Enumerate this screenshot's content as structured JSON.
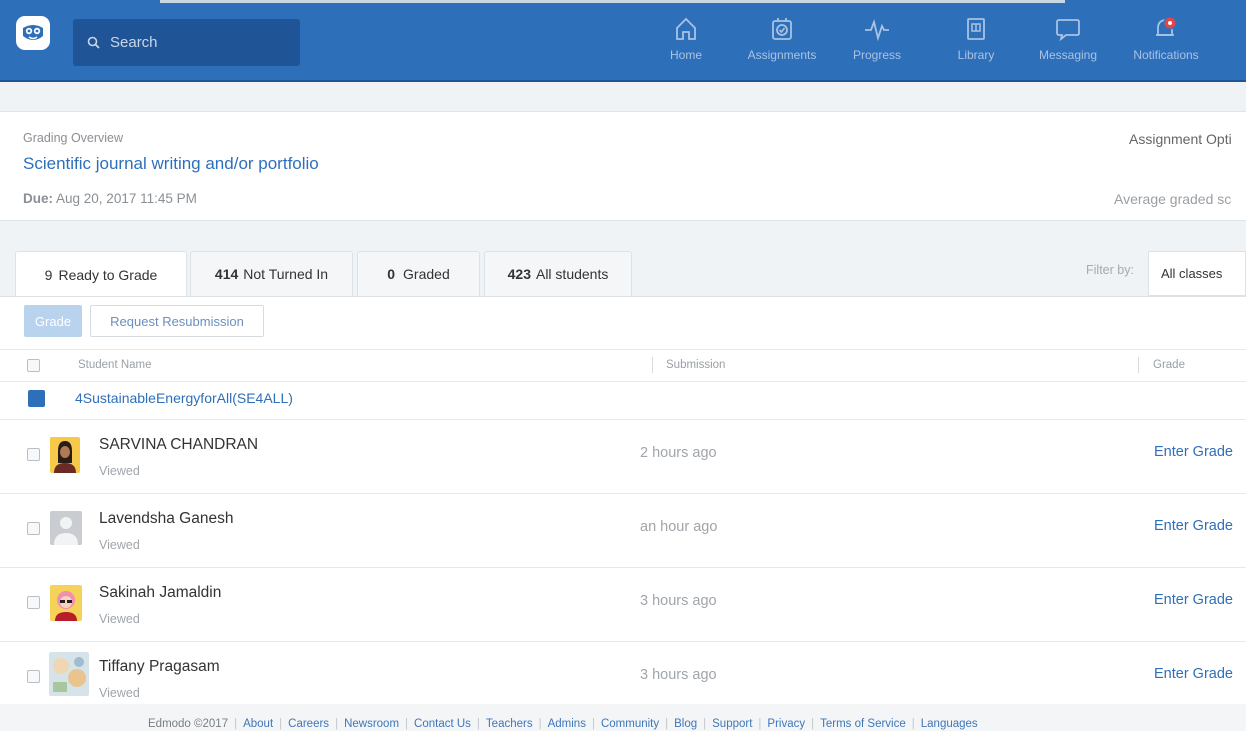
{
  "search": {
    "placeholder": "Search"
  },
  "nav": [
    {
      "label": "Home",
      "icon": "home-icon"
    },
    {
      "label": "Assignments",
      "icon": "assignments-icon"
    },
    {
      "label": "Progress",
      "icon": "progress-icon"
    },
    {
      "label": "Library",
      "icon": "library-icon"
    },
    {
      "label": "Messaging",
      "icon": "messaging-icon"
    },
    {
      "label": "Notifications",
      "icon": "notifications-icon"
    }
  ],
  "header": {
    "overview": "Grading Overview",
    "title": "Scientific journal writing and/or portfolio",
    "due_label": "Due:",
    "due_value": "Aug 20, 2017 11:45 PM",
    "assignment_options": "Assignment Opti",
    "average_graded": "Average graded sc"
  },
  "tabs": [
    {
      "count": "9",
      "label": "Ready to Grade"
    },
    {
      "count": "414",
      "label": "Not Turned In"
    },
    {
      "count": "0",
      "label": "Graded"
    },
    {
      "count": "423",
      "label": "All students"
    }
  ],
  "filter": {
    "label": "Filter by:",
    "value": "All classes"
  },
  "actions": {
    "grade": "Grade",
    "request_resubmission": "Request Resubmission"
  },
  "columns": {
    "student_name": "Student Name",
    "submission": "Submission",
    "grade": "Grade"
  },
  "group": {
    "name": "4SustainableEnergyforAll(SE4ALL)"
  },
  "students": [
    {
      "name": "SARVINA CHANDRAN",
      "status": "Viewed",
      "submission": "2 hours ago",
      "grade": "Enter Grade"
    },
    {
      "name": "Lavendsha Ganesh",
      "status": "Viewed",
      "submission": "an hour ago",
      "grade": "Enter Grade"
    },
    {
      "name": "Sakinah Jamaldin",
      "status": "Viewed",
      "submission": "3 hours ago",
      "grade": "Enter Grade"
    },
    {
      "name": "Tiffany Pragasam",
      "status": "Viewed",
      "submission": "3 hours ago",
      "grade": "Enter Grade"
    }
  ],
  "footer": {
    "copyright": "Edmodo ©2017",
    "links": [
      "About",
      "Careers",
      "Newsroom",
      "Contact Us",
      "Teachers",
      "Admins",
      "Community",
      "Blog",
      "Support",
      "Privacy",
      "Terms of Service",
      "Languages"
    ]
  },
  "colors": {
    "brand": "#2e6fba",
    "brand_dark": "#1f5596",
    "notification_dot": "#e0464a"
  }
}
